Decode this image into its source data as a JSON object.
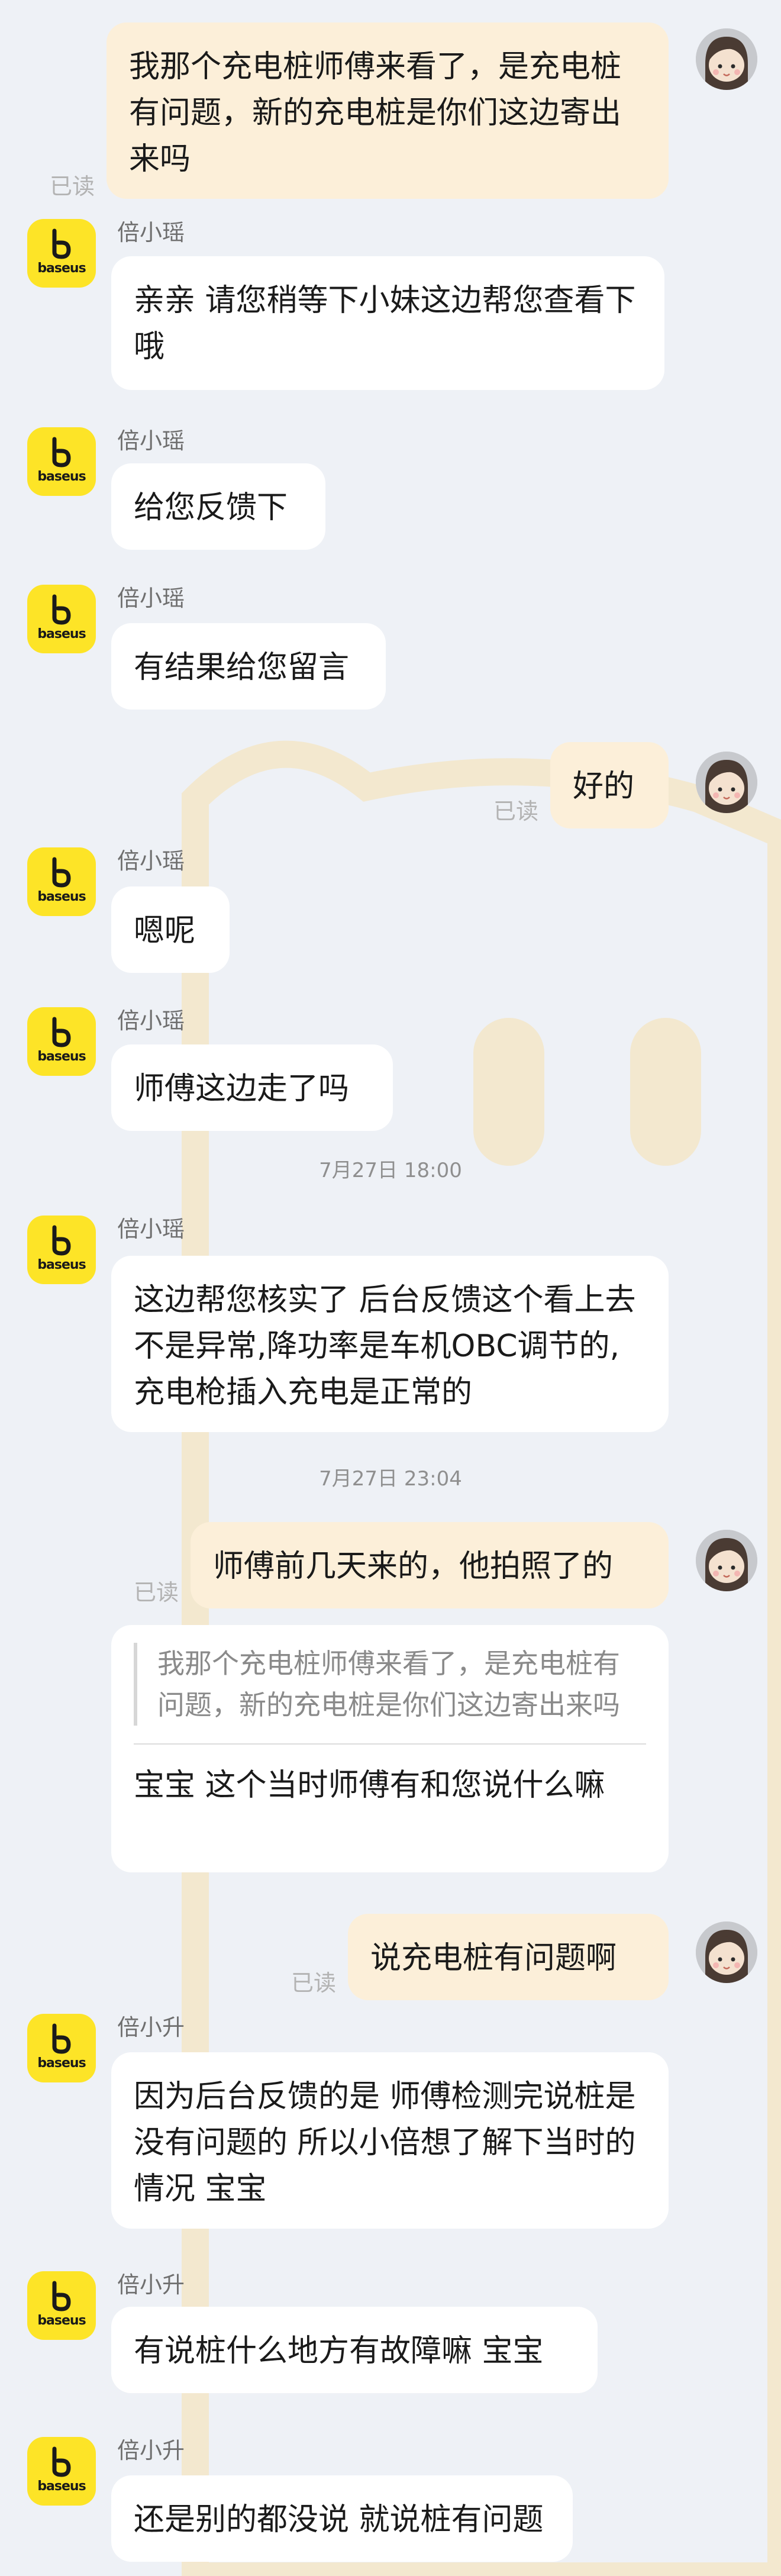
{
  "read_label": "已读",
  "brand": {
    "avatar_text": "baseus",
    "brand_color": "#fde427",
    "icon": "baseus-logo-icon"
  },
  "user": {
    "icon": "user-avatar-icon"
  },
  "colors": {
    "background": "#eef1f6",
    "incoming_bubble": "#ffffff",
    "outgoing_bubble": "#fcefd9",
    "read_text": "#b3b3b3"
  },
  "messages": [
    {
      "side": "out",
      "text": "我那个充电桩师傅来看了，是充电桩有问题，新的充电桩是你们这边寄出来吗",
      "read": true
    },
    {
      "side": "in",
      "sender": "倍小瑶",
      "text": "亲亲 请您稍等下小妹这边帮您查看下哦"
    },
    {
      "side": "in",
      "sender": "倍小瑶",
      "text": "给您反馈下"
    },
    {
      "side": "in",
      "sender": "倍小瑶",
      "text": "有结果给您留言"
    },
    {
      "side": "out",
      "text": "好的",
      "read": true
    },
    {
      "side": "in",
      "sender": "倍小瑶",
      "text": "嗯呢"
    },
    {
      "side": "in",
      "sender": "倍小瑶",
      "text": "师傅这边走了吗"
    },
    {
      "timestamp": "7月27日 18:00"
    },
    {
      "side": "in",
      "sender": "倍小瑶",
      "text": "这边帮您核实了 后台反馈这个看上去不是异常,降功率是车机OBC调节的,充电枪插入充电是正常的"
    },
    {
      "timestamp": "7月27日 23:04"
    },
    {
      "side": "out",
      "text": "师傅前几天来的，他拍照了的",
      "read": true
    },
    {
      "side": "in",
      "quote": "我那个充电桩师傅来看了，是充电桩有问题，新的充电桩是你们这边寄出来吗",
      "text": "宝宝 这个当时师傅有和您说什么嘛"
    },
    {
      "side": "out",
      "text": "说充电桩有问题啊",
      "read": true
    },
    {
      "side": "in",
      "sender": "倍小升",
      "text": "因为后台反馈的是 师傅检测完说桩是没有问题的 所以小倍想了解下当时的情况 宝宝"
    },
    {
      "side": "in",
      "sender": "倍小升",
      "text": "有说桩什么地方有故障嘛 宝宝"
    },
    {
      "side": "in",
      "sender": "倍小升",
      "text": "还是别的都没说 就说桩有问题"
    }
  ]
}
